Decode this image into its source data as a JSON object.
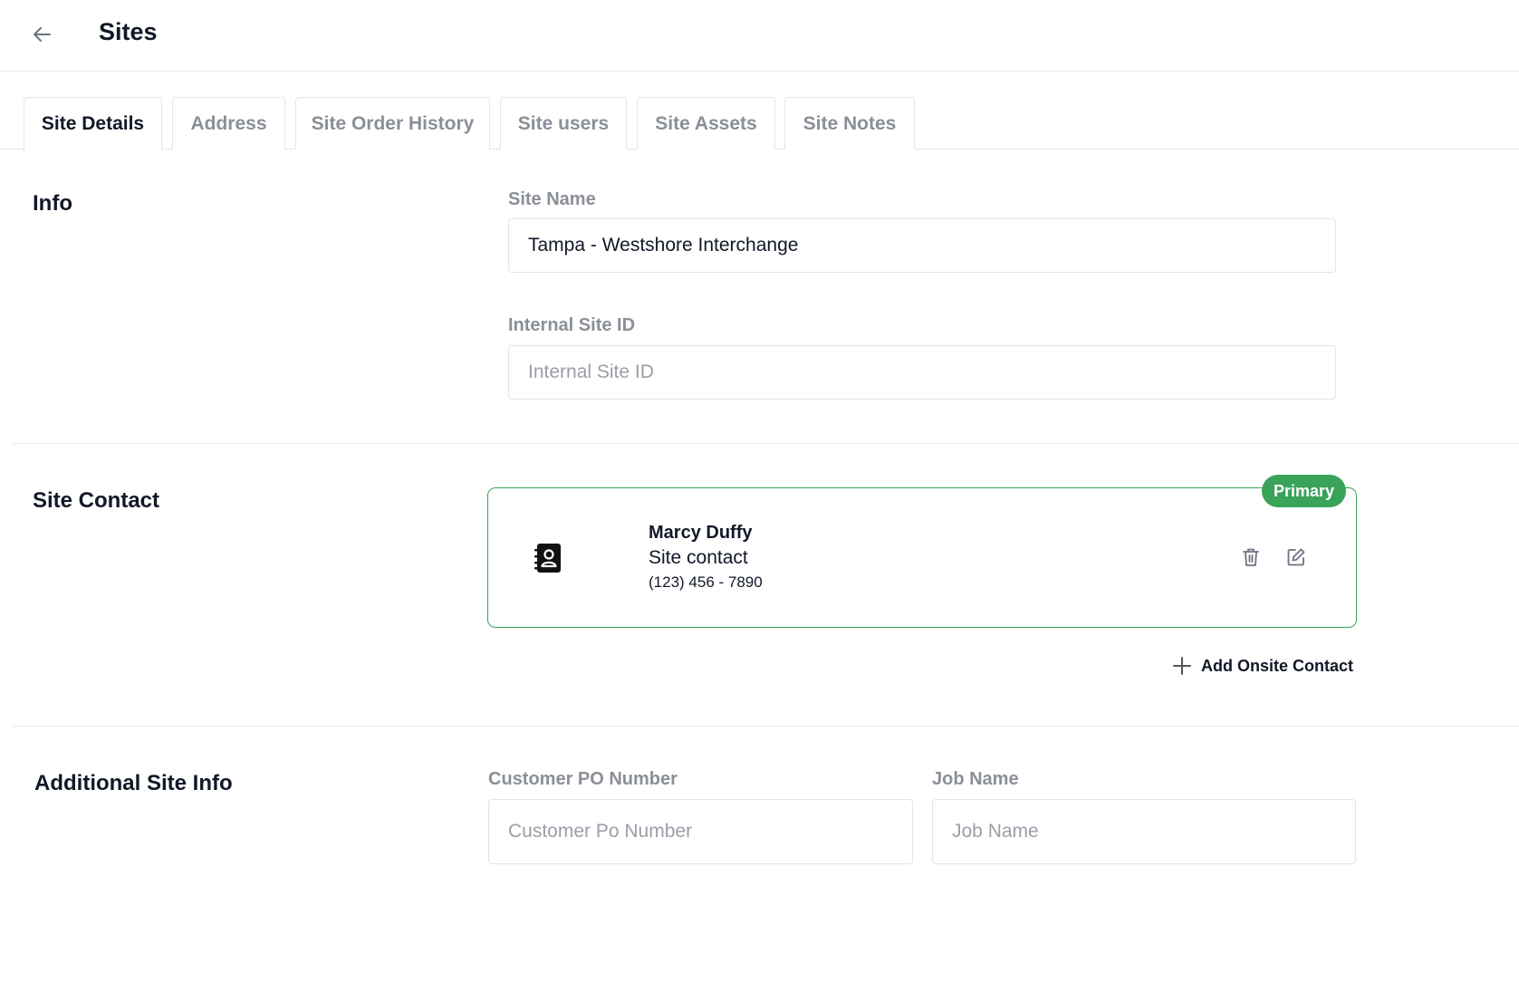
{
  "header": {
    "back_icon": "arrow-left-icon",
    "title": "Sites"
  },
  "tabs": [
    {
      "label": "Site Details",
      "active": true
    },
    {
      "label": "Address",
      "active": false
    },
    {
      "label": "Site Order History",
      "active": false
    },
    {
      "label": "Site users",
      "active": false
    },
    {
      "label": "Site Assets",
      "active": false
    },
    {
      "label": "Site Notes",
      "active": false
    }
  ],
  "info": {
    "title": "Info",
    "site_name": {
      "label": "Site Name",
      "value": "Tampa - Westshore Interchange",
      "placeholder": ""
    },
    "internal_site_id": {
      "label": "Internal Site ID",
      "value": "",
      "placeholder": "Internal Site ID"
    }
  },
  "site_contact": {
    "title": "Site Contact",
    "contact": {
      "icon": "contact-book-icon",
      "name": "Marcy Duffy",
      "role": "Site contact",
      "phone": "(123) 456 - 7890",
      "badge": "Primary",
      "delete_icon": "trash-icon",
      "edit_icon": "edit-icon"
    },
    "add_label": "Add Onsite Contact",
    "add_icon": "plus-icon"
  },
  "additional": {
    "title": "Additional Site Info",
    "po_number": {
      "label": "Customer PO Number",
      "value": "",
      "placeholder": "Customer Po Number"
    },
    "job_name": {
      "label": "Job Name",
      "value": "",
      "placeholder": "Job Name"
    }
  },
  "colors": {
    "accent_green": "#3aa35a",
    "muted_text": "#8a8f98",
    "primary_text": "#111827"
  }
}
